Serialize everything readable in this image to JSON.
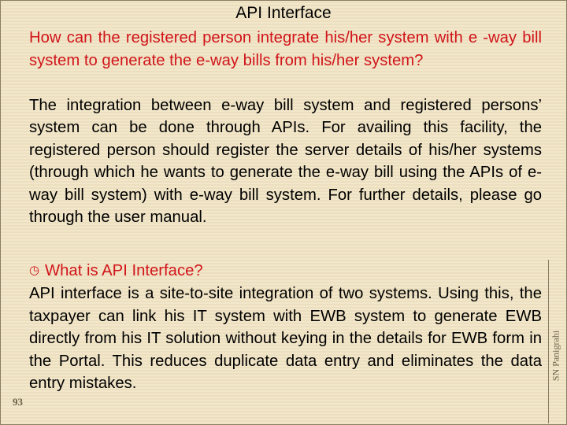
{
  "slide": {
    "title": "API Interface",
    "question": "How can the registered person integrate his/her system with e -way bill system to generate the e-way bills from his/her system?",
    "answer": "The integration between e-way bill system and registered persons’ system can be done through APIs. For availing this facility, the registered person should register the server details of his/her systems (through which he wants to generate the e-way bill using the APIs of e-way bill system) with e-way bill system. For further details, please go through the user manual.",
    "subheading": {
      "icon": "clock-icon",
      "glyph": "⌚",
      "text": "What is API Interface?"
    },
    "subheading_body": "API interface is a site-to-site integration of two systems. Using this, the taxpayer can link his IT system with EWB system to generate EWB directly from his IT solution without keying in the details for EWB form in the Portal. This reduces duplicate data entry and eliminates the data entry mistakes.",
    "page_number": "93",
    "author": "SN Panigrahi"
  },
  "colors": {
    "question": "#d1141a",
    "body": "#000000",
    "background": "#f1e4c6",
    "footer": "#6b5f46"
  }
}
